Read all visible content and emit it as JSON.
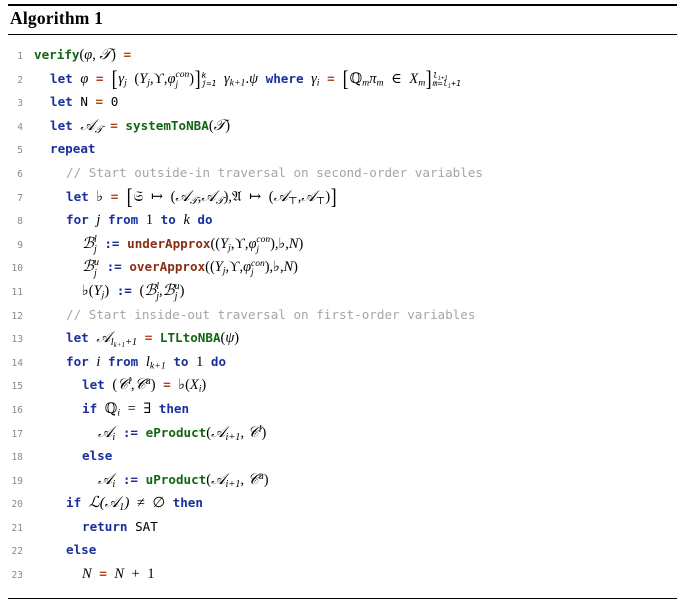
{
  "algorithm": {
    "title": "Algorithm 1",
    "lines": [
      {
        "n": "1",
        "text": "verify(φ, T) ="
      },
      {
        "n": "2",
        "text": "let φ = [γⱼ (Yⱼ, ϒ, φⱼ^con)]ⱼ₌₁^k γₖ₊₁.ψ where γᵢ = [ℚₘπₘ ∈ Xₘ]ₘ₌ₗᵢ₊₁^(lᵢ₊₁)"
      },
      {
        "n": "3",
        "text": "let N = 0"
      },
      {
        "n": "4",
        "text": "let A_T = systemToNBA(T)"
      },
      {
        "n": "5",
        "text": "repeat"
      },
      {
        "n": "6",
        "text": "// Start outside-in traversal on second-order variables"
      },
      {
        "n": "7",
        "text": "let ♭ = [𝔖 ↦ (A_T, A_T), 𝔄 ↦ (A_⊤, A_⊤)]"
      },
      {
        "n": "8",
        "text": "for j from 1 to k do"
      },
      {
        "n": "9",
        "text": "Bⱼ^l := underApprox((Yⱼ, ϒ, φⱼ^con), ♭, N)"
      },
      {
        "n": "10",
        "text": "Bⱼ^u := overApprox((Yⱼ, ϒ, φⱼ^con), ♭, N)"
      },
      {
        "n": "11",
        "text": "♭(Yⱼ) := (Bⱼ^l, Bⱼ^u)"
      },
      {
        "n": "12",
        "text": "// Start inside-out traversal on first-order variables"
      },
      {
        "n": "13",
        "text": "let A_{lₖ₊₁+1} = LTLtoNBA(ψ)"
      },
      {
        "n": "14",
        "text": "for i from lₖ₊₁ to 1 do"
      },
      {
        "n": "15",
        "text": "let (C^l, C^u) = ♭(Xᵢ)"
      },
      {
        "n": "16",
        "text": "if ℚᵢ = ∃ then"
      },
      {
        "n": "17",
        "text": "Aᵢ := eProduct(Aᵢ₊₁, C^l)"
      },
      {
        "n": "18",
        "text": "else"
      },
      {
        "n": "19",
        "text": "Aᵢ := uProduct(Aᵢ₊₁, C^u)"
      },
      {
        "n": "20",
        "text": "if L(A₁) ≠ ∅ then"
      },
      {
        "n": "21",
        "text": "return SAT"
      },
      {
        "n": "22",
        "text": "else"
      },
      {
        "n": "23",
        "text": "N = N + 1"
      }
    ],
    "keywords": [
      "let",
      "repeat",
      "for",
      "from",
      "to",
      "do",
      "if",
      "then",
      "else",
      "return",
      "where"
    ],
    "functions": [
      "verify",
      "systemToNBA",
      "LTLtoNBA",
      "eProduct",
      "uProduct"
    ],
    "approx_functions": [
      "underApprox",
      "overApprox"
    ],
    "comments": [
      "// Start outside-in traversal on second-order variables",
      "// Start inside-out traversal on first-order variables"
    ],
    "literals": [
      "0",
      "1",
      "SAT",
      "N"
    ],
    "colors": {
      "keyword": "#1a2f9e",
      "function": "#116611",
      "approx_function": "#8a2f14",
      "assign_equals": "#b5451a",
      "comment": "#a6a6a6",
      "linenumber": "#8a8a8a",
      "text": "#000000",
      "background": "#ffffff"
    }
  }
}
